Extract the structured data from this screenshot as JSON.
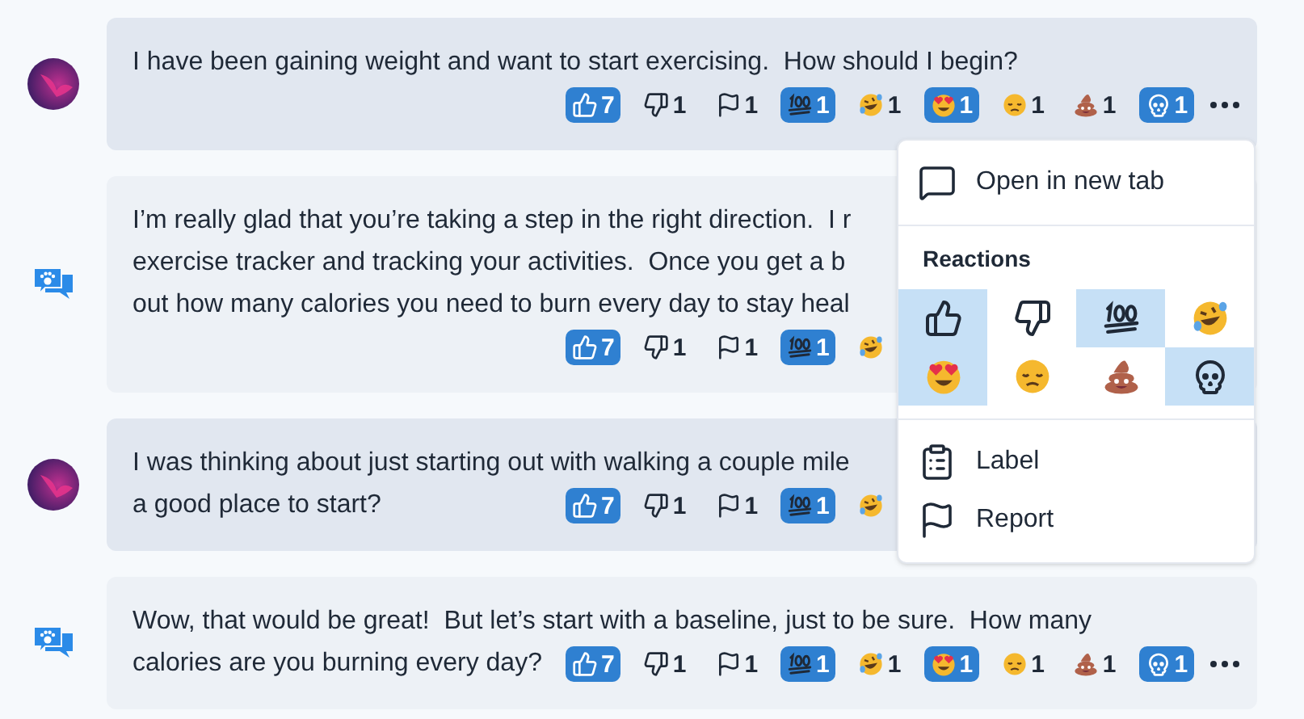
{
  "messages": [
    {
      "kind": "user",
      "lines": [
        "I have been gaining weight and want to start exercising.  How should I begin?"
      ],
      "reactions": [
        {
          "kind": "thumbs_up",
          "count": "7",
          "selected": true
        },
        {
          "kind": "thumbs_down",
          "count": "1",
          "selected": false
        },
        {
          "kind": "flag",
          "count": "1",
          "selected": false
        },
        {
          "kind": "hundred",
          "count": "1",
          "selected": true
        },
        {
          "kind": "rofl",
          "count": "1",
          "selected": false
        },
        {
          "kind": "heart_eyes",
          "count": "1",
          "selected": true
        },
        {
          "kind": "disappointed",
          "count": "1",
          "selected": false
        },
        {
          "kind": "poop",
          "count": "1",
          "selected": false
        },
        {
          "kind": "skull",
          "count": "1",
          "selected": true
        },
        {
          "kind": "more"
        }
      ]
    },
    {
      "kind": "bot",
      "lines": [
        "I’m really glad that you’re taking a step in the right direction.  I r",
        "exercise tracker and tracking your activities.  Once you get a b",
        "out how many calories you need to burn every day to stay heal"
      ],
      "reactions": [
        {
          "kind": "thumbs_up",
          "count": "7",
          "selected": true
        },
        {
          "kind": "thumbs_down",
          "count": "1",
          "selected": false
        },
        {
          "kind": "flag",
          "count": "1",
          "selected": false
        },
        {
          "kind": "hundred",
          "count": "1",
          "selected": true
        },
        {
          "kind": "rofl",
          "selected": false
        }
      ]
    },
    {
      "kind": "user",
      "lines": [
        "I was thinking about just starting out with walking a couple mile",
        "a good place to start?"
      ],
      "reactions": [
        {
          "kind": "thumbs_up",
          "count": "7",
          "selected": true
        },
        {
          "kind": "thumbs_down",
          "count": "1",
          "selected": false
        },
        {
          "kind": "flag",
          "count": "1",
          "selected": false
        },
        {
          "kind": "hundred",
          "count": "1",
          "selected": true
        },
        {
          "kind": "rofl",
          "selected": false
        }
      ]
    },
    {
      "kind": "bot",
      "lines": [
        "Wow, that would be great!  But let’s start with a baseline, just to be sure.  How many",
        "calories are you burning every day?"
      ],
      "reactions": [
        {
          "kind": "thumbs_up",
          "count": "7",
          "selected": true
        },
        {
          "kind": "thumbs_down",
          "count": "1",
          "selected": false
        },
        {
          "kind": "flag",
          "count": "1",
          "selected": false
        },
        {
          "kind": "hundred",
          "count": "1",
          "selected": true
        },
        {
          "kind": "rofl",
          "count": "1",
          "selected": false
        },
        {
          "kind": "heart_eyes",
          "count": "1",
          "selected": true
        },
        {
          "kind": "disappointed",
          "count": "1",
          "selected": false
        },
        {
          "kind": "poop",
          "count": "1",
          "selected": false
        },
        {
          "kind": "skull",
          "count": "1",
          "selected": true
        },
        {
          "kind": "more"
        }
      ]
    }
  ],
  "menu": {
    "top_items": [
      {
        "kind": "comment",
        "label": "Open in new tab"
      }
    ],
    "reactions_title": "Reactions",
    "reactions": [
      {
        "kind": "thumbs_up",
        "selected": true
      },
      {
        "kind": "thumbs_down",
        "selected": false
      },
      {
        "kind": "hundred",
        "selected": true
      },
      {
        "kind": "rofl",
        "selected": false
      },
      {
        "kind": "heart_eyes",
        "selected": true
      },
      {
        "kind": "disappointed",
        "selected": false
      },
      {
        "kind": "poop",
        "selected": false
      },
      {
        "kind": "skull",
        "selected": true
      }
    ],
    "bottom_items": [
      {
        "kind": "clipboard",
        "label": "Label"
      },
      {
        "kind": "flag",
        "label": "Report"
      }
    ]
  }
}
